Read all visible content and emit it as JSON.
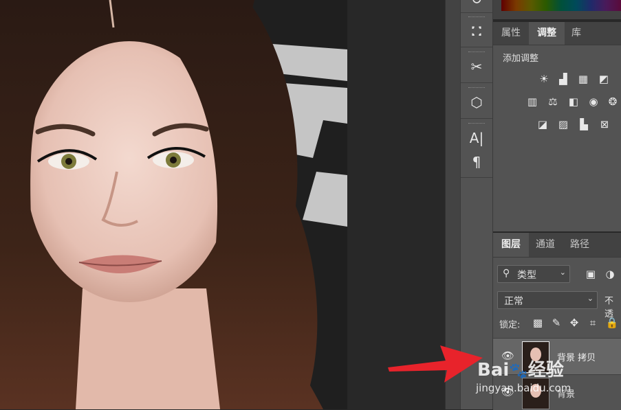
{
  "photo": {
    "backdrop_letters": "Pi"
  },
  "tools": [
    {
      "name": "rotate-tool-icon",
      "glyph": "↻"
    },
    {
      "name": "clone-source-icon",
      "glyph": "⛚"
    },
    {
      "name": "tool-presets-icon",
      "glyph": "✂"
    },
    {
      "name": "3d-icon",
      "glyph": "⬡"
    },
    {
      "name": "character-icon",
      "glyph": "A|"
    },
    {
      "name": "paragraph-icon",
      "glyph": "¶"
    }
  ],
  "adjust_panel": {
    "tabs": [
      "属性",
      "调整",
      "库"
    ],
    "active_tab": "调整",
    "heading": "添加调整"
  },
  "layers_panel": {
    "tabs": [
      "图层",
      "通道",
      "路径"
    ],
    "active_tab": "图层",
    "filter_label": "类型",
    "blend_mode": "正常",
    "opacity_label": "不透",
    "lock_label": "锁定:",
    "layers": [
      {
        "name": "背景 拷贝",
        "selected": true,
        "visible": true
      },
      {
        "name": "背景",
        "selected": false,
        "visible": true
      }
    ]
  },
  "watermark": {
    "brand": "Bai",
    "brand2": "经验",
    "url": "jingyan.baidu.com"
  },
  "colors": {
    "panel": "#535353",
    "selected_layer": "#666666",
    "arrow": "#e8232b"
  }
}
